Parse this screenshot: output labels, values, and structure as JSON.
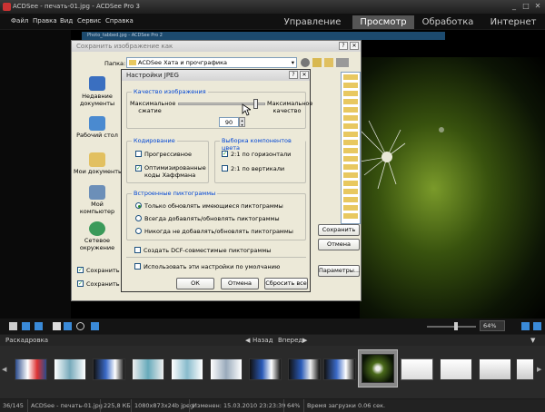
{
  "window": {
    "title": "ACDSee - печать-01.jpg - ACDSee Pro 3"
  },
  "menu": [
    "Файл",
    "Правка",
    "Вид",
    "Сервис",
    "Справка"
  ],
  "modes": [
    "Управление",
    "Просмотр",
    "Обработка",
    "Интернет"
  ],
  "bg_window": {
    "title": "Photo_tabbed.jpg - ACDSee Pro 2"
  },
  "save_dialog": {
    "title": "Сохранить изображение как",
    "folder_label": "Папка:",
    "folder_value": "ACDSee Хата и прочграфика",
    "places": [
      "Недавние документы",
      "Рабочий стол",
      "Мои документы",
      "Мой компьютер",
      "Сетевое окружение"
    ],
    "save_button": "Сохранить",
    "cancel_button": "Отмена",
    "params_button": "Параметры...",
    "check1": "Сохранить ме",
    "check2": "Сохранить им"
  },
  "jpeg_dialog": {
    "title": "Настройки JPEG",
    "quality_group": "Качество изображения",
    "max_compression": "Максимальное сжатие",
    "max_quality": "Максимальное качество",
    "quality_value": "90",
    "quality_fraction": 0.9,
    "encoding_group": "Кодирование",
    "progressive": "Прогрессивное",
    "huffman": "Оптимизированные коды Хаффмана",
    "sampling_group": "Выборка компонентов цвета",
    "h21": "2:1 по горизонтали",
    "v21": "2:1 по вертикали",
    "thumbs_group": "Встроенные пиктограммы",
    "radio1": "Только обновлять имеющиеся пиктограммы",
    "radio2": "Всегда добавлять/обновлять пиктограммы",
    "radio3": "Никогда не добавлять/обновлять пиктограммы",
    "dcf": "Создать DCF-совместимые пиктограммы",
    "default": "Использовать эти настройки по умолчанию",
    "ok": "ОК",
    "cancel": "Отмена",
    "reset": "Сбросить все"
  },
  "toolbar": {
    "zoom": "64%"
  },
  "filmstrip": {
    "label": "Раскадровка",
    "back": "Назад",
    "forward": "Вперед"
  },
  "status": {
    "count": "36/145",
    "file": "ACDSee - печать-01.jpg",
    "size": "225,8 КБ",
    "dims": "1080x873x24b jpeg",
    "modified": "Изменен: 15.03.2010 23:23:39",
    "zoom": "64%",
    "load": "Время загрузки 0.06 сек."
  }
}
